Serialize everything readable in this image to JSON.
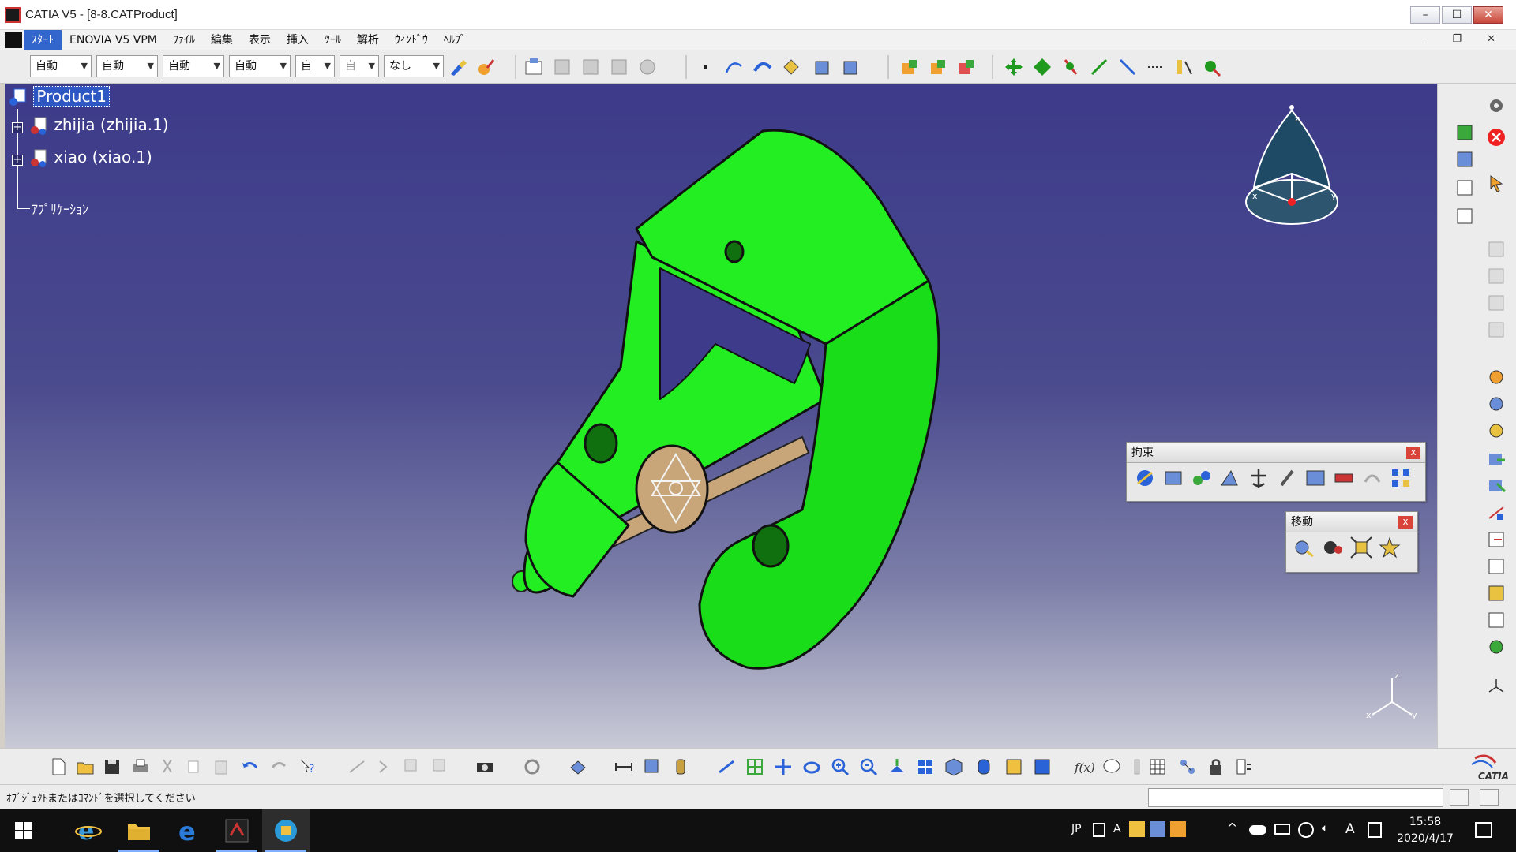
{
  "window": {
    "title": "CATIA V5 - [8-8.CATProduct]",
    "controls": {
      "minimize": "–",
      "maximize": "☐",
      "close": "✕"
    }
  },
  "menubar": {
    "items": [
      "ｽﾀｰﾄ",
      "ENOVIA V5 VPM",
      "ﾌｧｲﾙ",
      "編集",
      "表示",
      "挿入",
      "ﾂｰﾙ",
      "解析",
      "ｳｨﾝﾄﾞｳ",
      "ﾍﾙﾌﾟ"
    ],
    "mdi_controls": "– ❐ ✕"
  },
  "toolbar": {
    "combos": [
      "自動",
      "自動",
      "自動",
      "自動",
      "自",
      "自",
      "なし"
    ]
  },
  "tree": {
    "root": "Product1",
    "children": [
      "zhijia (zhijia.1)",
      "xiao (xiao.1)"
    ],
    "applications": "ｱﾌﾟﾘｹｰｼｮﾝ"
  },
  "compass": {
    "z": "z",
    "x": "x",
    "y": "y"
  },
  "axis": {
    "z": "z",
    "x": "x",
    "y": "y"
  },
  "palettes": {
    "constraint": {
      "title": "拘束",
      "close": "x"
    },
    "move": {
      "title": "移動",
      "close": "x"
    }
  },
  "statusbar": {
    "message": "ｵﾌﾞｼﾞｪｸﾄまたはｺﾏﾝﾄﾞを選択してください"
  },
  "brand": "CATIA",
  "taskbar": {
    "ime": "JP",
    "ime_mode": "A",
    "lang_icon": "A",
    "time": "15:58",
    "date": "2020/4/17"
  },
  "colors": {
    "part_green": "#22ee22",
    "pin_tan": "#c8a67a",
    "viewport_top": "#3d3b8a",
    "selection_blue": "#2d57c2"
  }
}
